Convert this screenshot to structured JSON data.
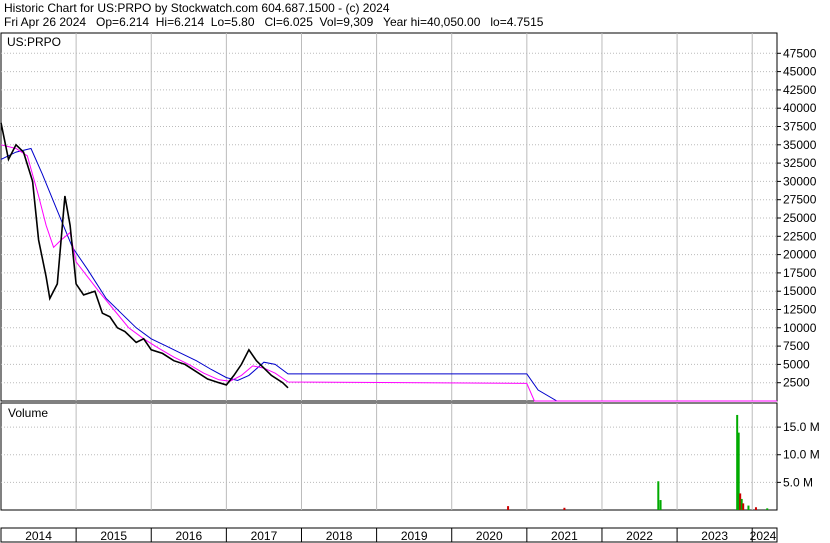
{
  "header": {
    "title_line": "Historic Chart for US:PRPO by Stockwatch.com 604.687.1500 - (c) 2024",
    "quote_line": "Fri Apr 26 2024   Op=6.214  Hi=6.214  Lo=5.80   Cl=6.025  Vol=9,309   Year hi=40,050.00   lo=4.7515"
  },
  "chart_data": [
    {
      "type": "line",
      "symbol_label": "US:PRPO",
      "ylim": [
        0,
        50000
      ],
      "y_ticks": [
        2500,
        5000,
        7500,
        10000,
        12500,
        15000,
        17500,
        20000,
        22500,
        25000,
        27500,
        30000,
        32500,
        35000,
        37500,
        40000,
        42500,
        45000,
        47500
      ],
      "x_range": [
        2014.0,
        2024.33
      ],
      "colors": {
        "price": "#000000",
        "ma_short": "#ff00ff",
        "ma_long": "#0000cc",
        "grid": "#bbbbbb"
      },
      "series": [
        {
          "role": "price",
          "points": [
            [
              2014.0,
              38000
            ],
            [
              2014.1,
              33000
            ],
            [
              2014.2,
              35000
            ],
            [
              2014.3,
              34000
            ],
            [
              2014.42,
              30000
            ],
            [
              2014.5,
              22000
            ],
            [
              2014.6,
              17000
            ],
            [
              2014.65,
              14000
            ],
            [
              2014.75,
              16000
            ],
            [
              2014.85,
              28000
            ],
            [
              2014.92,
              24000
            ],
            [
              2015.0,
              16000
            ],
            [
              2015.1,
              14500
            ],
            [
              2015.25,
              15000
            ],
            [
              2015.35,
              12000
            ],
            [
              2015.45,
              11500
            ],
            [
              2015.55,
              10000
            ],
            [
              2015.65,
              9500
            ],
            [
              2015.8,
              8000
            ],
            [
              2015.9,
              8500
            ],
            [
              2016.0,
              7000
            ],
            [
              2016.15,
              6500
            ],
            [
              2016.3,
              5500
            ],
            [
              2016.45,
              5000
            ],
            [
              2016.6,
              4000
            ],
            [
              2016.75,
              3000
            ],
            [
              2016.9,
              2500
            ],
            [
              2017.0,
              2200
            ],
            [
              2017.1,
              3500
            ],
            [
              2017.2,
              5000
            ],
            [
              2017.3,
              7000
            ],
            [
              2017.4,
              5500
            ],
            [
              2017.5,
              4500
            ],
            [
              2017.6,
              3500
            ],
            [
              2017.75,
              2500
            ],
            [
              2017.82,
              1800
            ]
          ]
        },
        {
          "role": "ma_short",
          "points": [
            [
              2014.0,
              35000
            ],
            [
              2014.2,
              34500
            ],
            [
              2014.35,
              33500
            ],
            [
              2014.5,
              28000
            ],
            [
              2014.6,
              24000
            ],
            [
              2014.7,
              21000
            ],
            [
              2014.8,
              22000
            ],
            [
              2014.92,
              23000
            ],
            [
              2015.0,
              19000
            ],
            [
              2015.15,
              17000
            ],
            [
              2015.3,
              15000
            ],
            [
              2015.5,
              12500
            ],
            [
              2015.7,
              10000
            ],
            [
              2015.9,
              8500
            ],
            [
              2016.1,
              7200
            ],
            [
              2016.3,
              6000
            ],
            [
              2016.5,
              5000
            ],
            [
              2016.7,
              3800
            ],
            [
              2016.9,
              2900
            ],
            [
              2017.05,
              2700
            ],
            [
              2017.2,
              3500
            ],
            [
              2017.35,
              4800
            ],
            [
              2017.5,
              4500
            ],
            [
              2017.65,
              3800
            ],
            [
              2017.82,
              2600
            ],
            [
              2021.0,
              2400
            ],
            [
              2021.1,
              0
            ],
            [
              2024.33,
              0
            ]
          ]
        },
        {
          "role": "ma_long",
          "points": [
            [
              2014.0,
              33000
            ],
            [
              2014.2,
              34000
            ],
            [
              2014.4,
              34500
            ],
            [
              2014.55,
              31000
            ],
            [
              2014.75,
              26000
            ],
            [
              2014.95,
              21000
            ],
            [
              2015.15,
              18000
            ],
            [
              2015.4,
              14000
            ],
            [
              2015.6,
              12000
            ],
            [
              2015.8,
              10000
            ],
            [
              2016.0,
              8500
            ],
            [
              2016.2,
              7500
            ],
            [
              2016.4,
              6500
            ],
            [
              2016.6,
              5500
            ],
            [
              2016.8,
              4300
            ],
            [
              2017.0,
              3200
            ],
            [
              2017.15,
              2800
            ],
            [
              2017.3,
              3500
            ],
            [
              2017.5,
              5300
            ],
            [
              2017.65,
              5000
            ],
            [
              2017.82,
              3700
            ],
            [
              2021.0,
              3700
            ],
            [
              2021.15,
              1500
            ],
            [
              2021.4,
              0
            ],
            [
              2024.33,
              0
            ]
          ]
        }
      ]
    },
    {
      "type": "bar",
      "panel_label": "Volume",
      "ylim": [
        0,
        19000000
      ],
      "y_ticks": [
        {
          "value": 5000000,
          "label": "5.0 M"
        },
        {
          "value": 10000000,
          "label": "10.0 M"
        },
        {
          "value": 15000000,
          "label": "15.0 M"
        }
      ],
      "x_labels": [
        "2014",
        "2015",
        "2016",
        "2017",
        "2018",
        "2019",
        "2020",
        "2021",
        "2022",
        "2023",
        "2024"
      ],
      "colors": {
        "up": "#00aa00",
        "down": "#cc0000"
      },
      "bars": [
        {
          "x": 2020.75,
          "value": 700000,
          "dir": "down"
        },
        {
          "x": 2021.5,
          "value": 400000,
          "dir": "down"
        },
        {
          "x": 2022.75,
          "value": 5200000,
          "dir": "up"
        },
        {
          "x": 2022.78,
          "value": 1800000,
          "dir": "up"
        },
        {
          "x": 2023.8,
          "value": 17200000,
          "dir": "up"
        },
        {
          "x": 2023.82,
          "value": 14000000,
          "dir": "up"
        },
        {
          "x": 2023.84,
          "value": 3000000,
          "dir": "down"
        },
        {
          "x": 2023.86,
          "value": 2000000,
          "dir": "up"
        },
        {
          "x": 2023.88,
          "value": 1200000,
          "dir": "down"
        },
        {
          "x": 2023.95,
          "value": 800000,
          "dir": "up"
        },
        {
          "x": 2024.05,
          "value": 500000,
          "dir": "down"
        },
        {
          "x": 2024.2,
          "value": 300000,
          "dir": "up"
        }
      ]
    }
  ]
}
